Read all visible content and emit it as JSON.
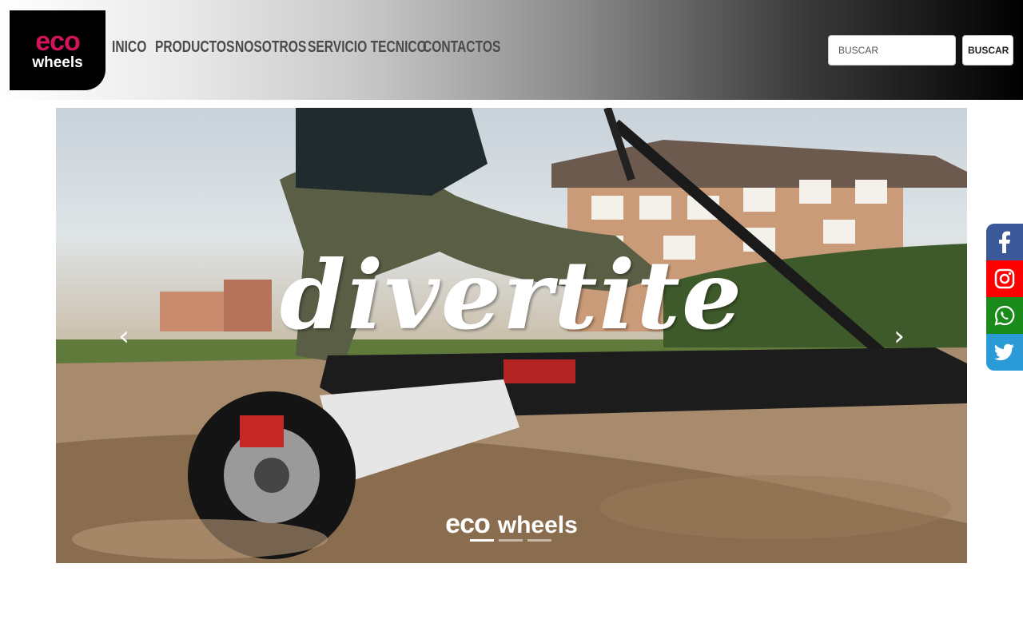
{
  "header": {
    "logo": {
      "top": "eco",
      "bottom": "wheels"
    },
    "nav": [
      {
        "label": "INICO"
      },
      {
        "label": "PRODUCTOS"
      },
      {
        "label": "NOSOTROS"
      },
      {
        "label": "SERVICIO TECNICO"
      },
      {
        "label": "CONTACTOS"
      }
    ],
    "search": {
      "placeholder": "BUSCAR",
      "button_label": "BUSCAR"
    }
  },
  "carousel": {
    "slide_text": "divertite",
    "brand_top": "eco",
    "brand_bottom": "wheels",
    "prev_icon": "chevron-left-icon",
    "next_icon": "chevron-right-icon",
    "indicator_count": 3,
    "active_indicator": 1
  },
  "social": [
    {
      "name": "facebook-icon",
      "color": "#3b5998"
    },
    {
      "name": "instagram-icon",
      "color": "#ff0000"
    },
    {
      "name": "whatsapp-icon",
      "color": "#1a8a1a"
    },
    {
      "name": "twitter-icon",
      "color": "#2a9bd6"
    }
  ],
  "colors": {
    "brand": "#d4145a",
    "header_dark": "#000000"
  }
}
